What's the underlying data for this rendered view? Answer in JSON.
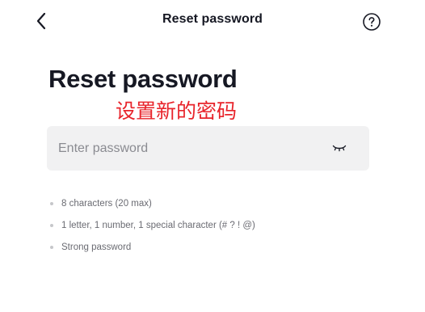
{
  "header": {
    "title": "Reset password",
    "back_icon": "chevron-left-icon",
    "help_icon": "question-circle-icon"
  },
  "main": {
    "title": "Reset password",
    "annotation": "设置新的密码",
    "annotation_color": "#e8242b"
  },
  "password_field": {
    "placeholder": "Enter password",
    "value": "",
    "toggle_icon": "eye-closed-icon"
  },
  "requirements": [
    {
      "text": "8 characters (20 max)"
    },
    {
      "text": "1 letter, 1 number, 1 special character (# ? ! @)"
    },
    {
      "text": "Strong password"
    }
  ],
  "colors": {
    "text_primary": "#161823",
    "placeholder": "#8a8b91",
    "field_background": "#f1f1f2",
    "hint_text": "#6a6b72",
    "hint_dot": "#c6c7ca"
  }
}
